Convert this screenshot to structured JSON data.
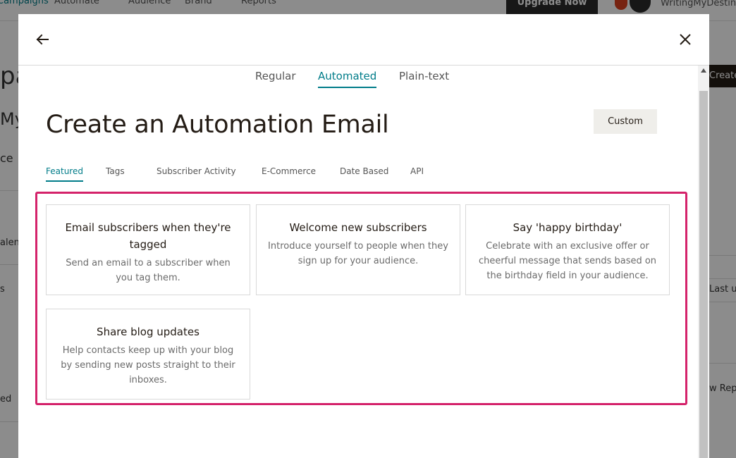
{
  "background": {
    "nav_items": [
      "Campaigns",
      "Automate",
      "Audience",
      "Brand",
      "Reports"
    ],
    "upgrade_label": "Upgrade Now",
    "user_name": "WritingMyDestiny",
    "left_fragments": [
      "pa",
      "My",
      "ce",
      "alen",
      "s",
      "ed"
    ],
    "right_button": "Create C",
    "right_fragments": [
      "Last u",
      "w Rep"
    ]
  },
  "modal": {
    "type_tabs": [
      {
        "label": "Regular"
      },
      {
        "label": "Automated"
      },
      {
        "label": "Plain-text"
      }
    ],
    "title": "Create an Automation Email",
    "custom_label": "Custom",
    "category_tabs": [
      {
        "label": "Featured"
      },
      {
        "label": "Tags"
      },
      {
        "label": "Subscriber Activity"
      },
      {
        "label": "E-Commerce"
      },
      {
        "label": "Date Based"
      },
      {
        "label": "API"
      }
    ],
    "cards": [
      {
        "title": "Email subscribers when they're tagged",
        "description": "Send an email to a subscriber when you tag them."
      },
      {
        "title": "Welcome new subscribers",
        "description": "Introduce yourself to people when they sign up for your audience."
      },
      {
        "title": "Say 'happy birthday'",
        "description": "Celebrate with an exclusive offer or cheerful message that sends based on the birthday field in your audience."
      },
      {
        "title": "Share blog updates",
        "description": "Help contacts keep up with your blog by sending new posts straight to their inboxes."
      }
    ]
  },
  "colors": {
    "accent": "#007c89",
    "highlight": "#d4226a",
    "text": "#241c15"
  },
  "icons": {
    "back": "arrow-left-icon",
    "close": "close-icon"
  }
}
